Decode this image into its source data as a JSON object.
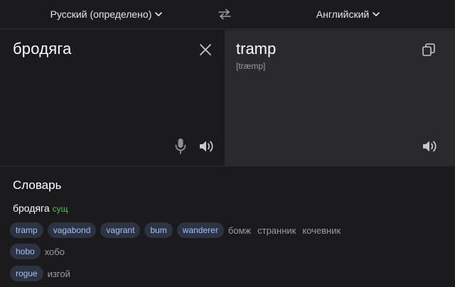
{
  "lang_bar": {
    "source_lang": "Русский (определено)",
    "target_lang": "Английский"
  },
  "source": {
    "text": "бродяга"
  },
  "target": {
    "text": "tramp",
    "transcription": "[træmp]"
  },
  "dictionary": {
    "title": "Словарь",
    "headword": "бродяга",
    "pos": "сущ",
    "groups": [
      {
        "translations": [
          "tramp",
          "vagabond",
          "vagrant",
          "bum",
          "wanderer"
        ],
        "back": [
          "бомж",
          "странник",
          "кочевник"
        ]
      },
      {
        "translations": [
          "hobo"
        ],
        "back": [
          "хобо"
        ]
      },
      {
        "translations": [
          "rogue"
        ],
        "back": [
          "изгой"
        ]
      }
    ]
  },
  "colors": {
    "background": "#1b1b1d",
    "target_pane": "#2a2a2c",
    "chip_bg": "#2d3340",
    "chip_text": "#9ec3ff",
    "pos_green": "#4cc05a"
  },
  "icons": {
    "swap": "swap-arrows-icon",
    "clear": "close-icon",
    "mic": "microphone-icon",
    "speak": "speaker-icon",
    "copy": "copy-icon",
    "dropdown": "chevron-down-icon"
  }
}
